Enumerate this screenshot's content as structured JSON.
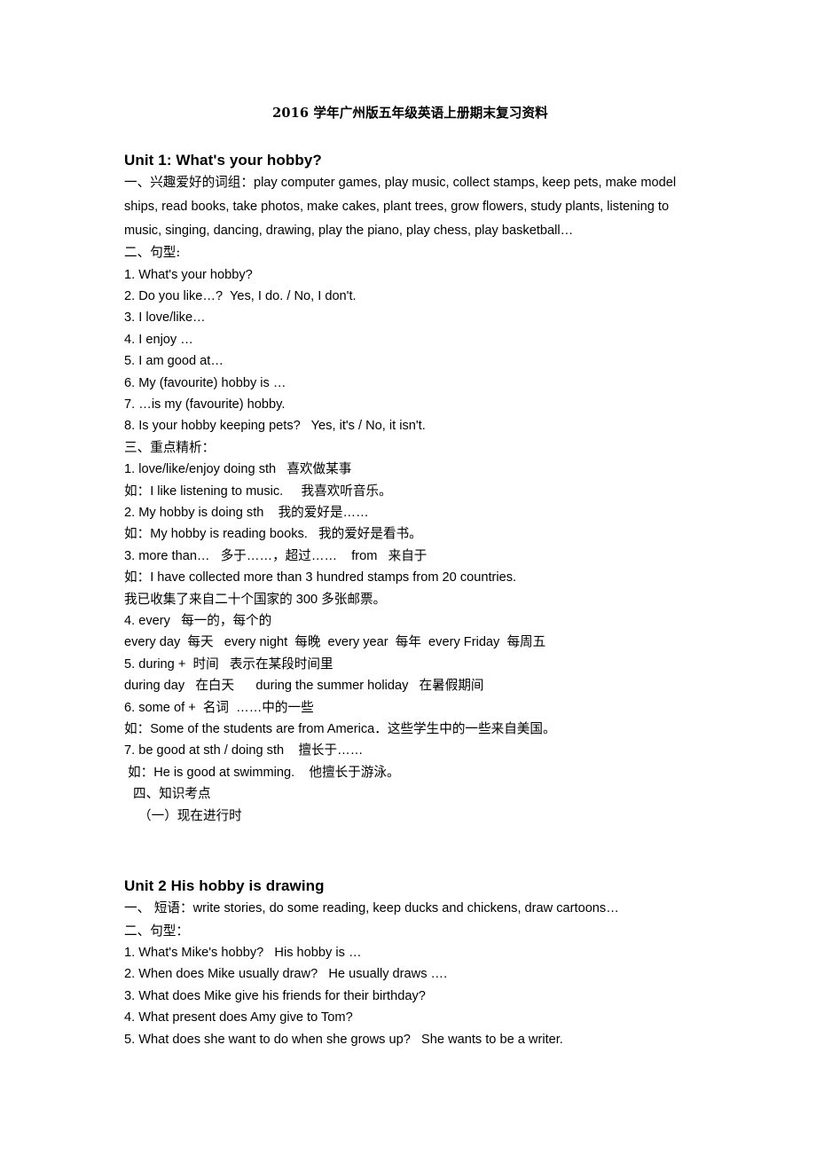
{
  "document": {
    "title": "2016 学年广州版五年级英语上册期末复习资料"
  },
  "unit1": {
    "heading": "Unit 1:  What's your hobby?",
    "section1_label": "一、兴趣爱好的词组：",
    "section1_body": "play computer games, play music, collect stamps, keep pets, make model ships, read books, take photos, make cakes, plant trees, grow flowers, study plants, listening to music, singing, dancing, drawing, play the piano, play chess, play basketball…",
    "section2_label": "二、句型:",
    "sentences": [
      "1. What's your hobby?",
      "2. Do you like…?  Yes, I do. / No, I don't.",
      "3. I love/like…",
      "4. I enjoy …",
      "5. I am good at…",
      "6. My (favourite) hobby is …",
      "7. …is my (favourite) hobby.",
      "8. Is your hobby keeping pets?   Yes, it's / No, it isn't."
    ],
    "section3_label": "三、重点精析：",
    "points": [
      "1. love/like/enjoy doing sth   喜欢做某事",
      "如：I like listening to music.     我喜欢听音乐。",
      "2. My hobby is doing sth    我的爱好是……",
      "如：My hobby is reading books.   我的爱好是看书。",
      "3. more than…   多于……，超过……    from   来自于",
      "如：I have collected more than 3 hundred stamps from 20 countries.",
      "我已收集了来自二十个国家的 300 多张邮票。",
      "4. every   每一的，每个的",
      "every day  每天   every night  每晚  every year  每年  every Friday  每周五",
      "5. during +  时间   表示在某段时间里",
      "during day   在白天      during the summer holiday   在暑假期间",
      "6. some of +  名词  ……中的一些",
      "如：Some of the students are from America．这些学生中的一些来自美国。",
      "7. be good at sth / doing sth    擅长于……",
      "如：He is good at swimming.    他擅长于游泳。"
    ],
    "section4_label": "四、知识考点",
    "section4_sub": "（一）现在进行时"
  },
  "unit2": {
    "heading": "Unit 2 His hobby is drawing",
    "section1_label": "一、 短语：",
    "section1_body": "write stories, do some reading, keep ducks and chickens, draw cartoons…",
    "section2_label": "二、句型：",
    "sentences": [
      "1. What's Mike's hobby?   His hobby is …",
      "2. When does Mike usually draw?   He usually draws ….",
      "3. What does Mike give his friends for their birthday?",
      "4. What present does Amy give to Tom?",
      "5. What does she want to do when she grows up?   She wants to be a writer."
    ]
  }
}
